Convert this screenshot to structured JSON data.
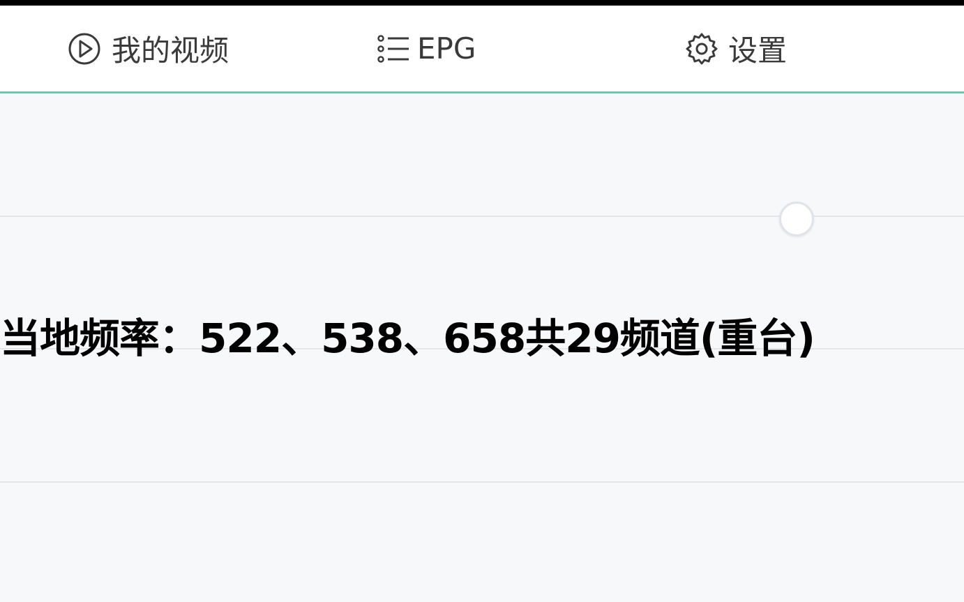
{
  "tabs": {
    "videos": {
      "label": "我的视频",
      "icon": "play-circle-icon"
    },
    "epg": {
      "label": "EPG",
      "icon": "list-icon"
    },
    "settings": {
      "label": "设置",
      "icon": "gear-icon"
    }
  },
  "caption": "当地频率：522、538、658共29频道(重台)",
  "colors": {
    "accent": "#5fcfae",
    "tab_text": "#3a3a3a",
    "background": "#f7f8fa"
  }
}
